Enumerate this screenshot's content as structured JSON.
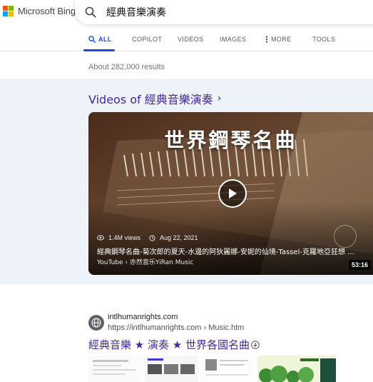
{
  "brand": {
    "name": "Microsoft Bing"
  },
  "search": {
    "query": "經典音樂演奏"
  },
  "tabs": [
    {
      "label": "ALL",
      "active": true,
      "icon": "search-icon"
    },
    {
      "label": "COPILOT",
      "active": false
    },
    {
      "label": "VIDEOS",
      "active": false
    },
    {
      "label": "IMAGES",
      "active": false
    },
    {
      "label": "MORE",
      "active": false,
      "icon": "more-vertical-icon"
    },
    {
      "label": "TOOLS",
      "active": false
    }
  ],
  "results": {
    "count_text": "About 282,000 results"
  },
  "videos": {
    "heading": "Videos of 經典音樂演奏",
    "card": {
      "thumb_title": "世界鋼琴名曲",
      "views": "1.4M views",
      "date": "Aug 22, 2021",
      "title": "經典鋼琴名曲-菊次郎的夏天-水邊的阿狄麗娜-安妮的仙境-Tassel-克羅地亞狂想 ...",
      "source": "YouTube › 亦然音乐YiRan Music",
      "duration": "53:16"
    }
  },
  "web_result": {
    "site_name": "intlhumanrights.com",
    "url": "https://intlhumanrights.com › Music.htm",
    "title": "經典音樂 ★ 演奏 ★ 世界各國名曲"
  },
  "colors": {
    "accent_blue": "#174ae4",
    "link_purple": "#4527a0",
    "section_bg": "#eef3f9",
    "ms_red": "#f25022",
    "ms_green": "#7fba00",
    "ms_blue": "#00a4ef",
    "ms_yellow": "#ffb900"
  }
}
